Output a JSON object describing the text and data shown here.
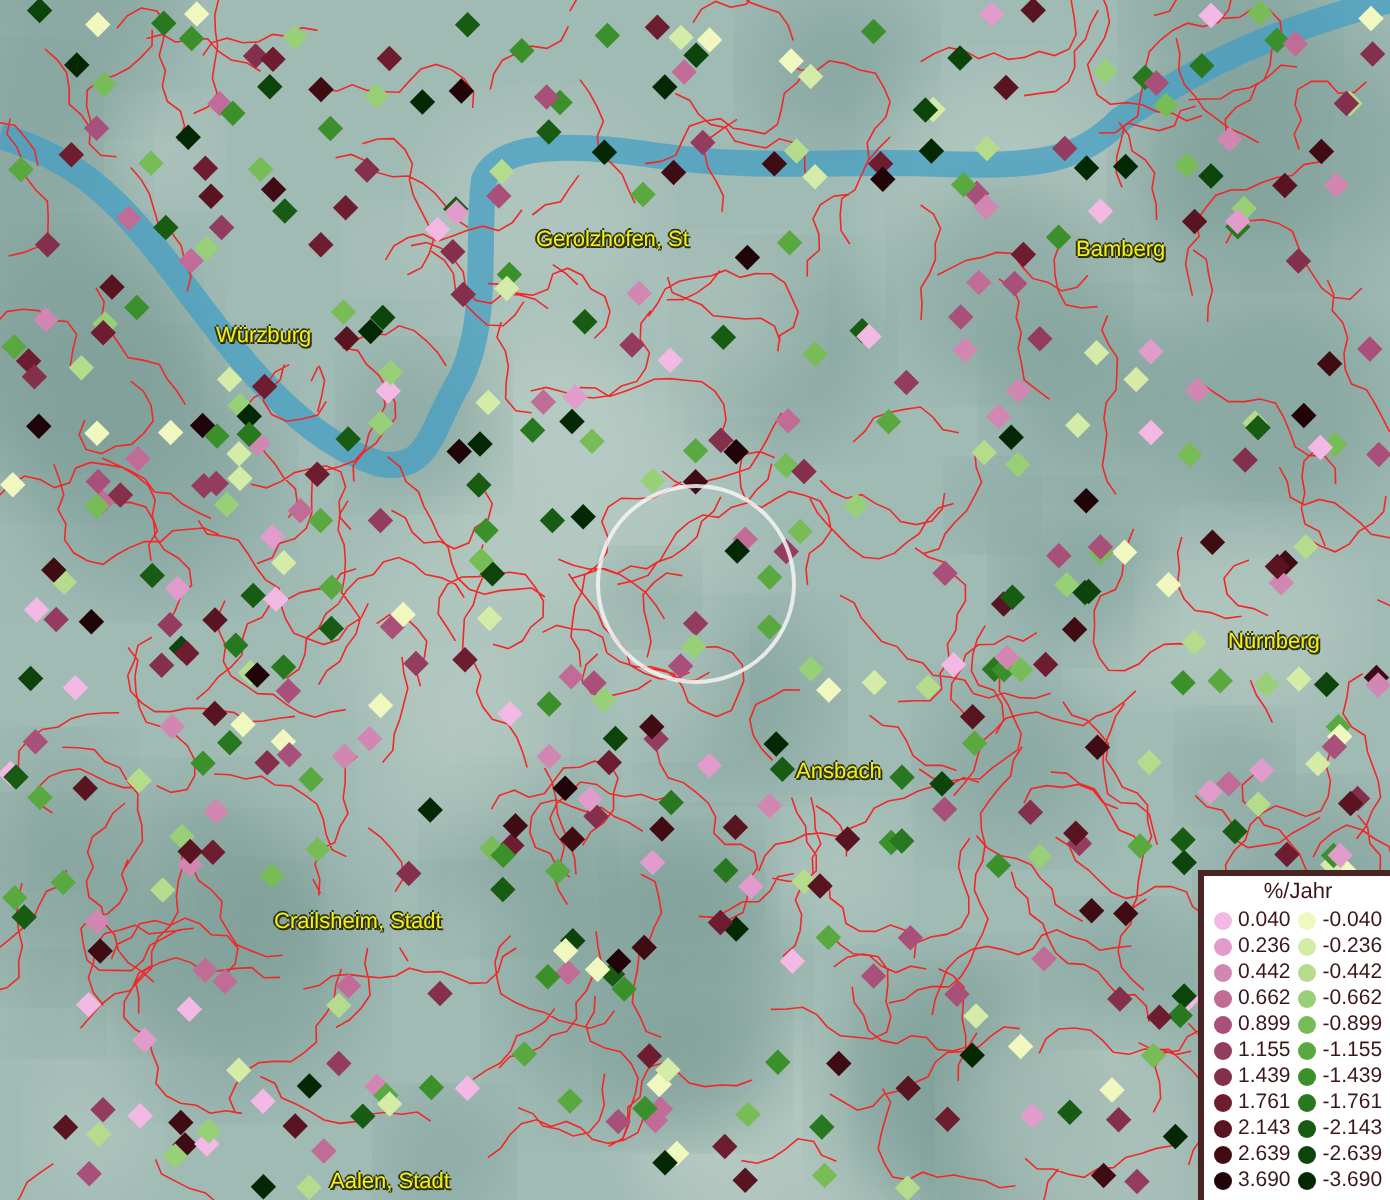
{
  "map": {
    "places": [
      {
        "name": "Würzburg"
      },
      {
        "name": "Gerolzhofen, St"
      },
      {
        "name": "Bamberg"
      },
      {
        "name": "Nürnberg"
      },
      {
        "name": "Ansbach"
      },
      {
        "name": "Crailsheim, Stadt"
      },
      {
        "name": "Aalen, Stadt"
      }
    ]
  },
  "legend": {
    "title": "%/Jahr",
    "entries": [
      {
        "label": "0.040",
        "color": "#f4b8e4"
      },
      {
        "label": "-0.040",
        "color": "#f0f8c0"
      },
      {
        "label": "0.236",
        "color": "#e29ccc"
      },
      {
        "label": "-0.236",
        "color": "#d4eca8"
      },
      {
        "label": "0.442",
        "color": "#d286b2"
      },
      {
        "label": "-0.442",
        "color": "#b4dc8c"
      },
      {
        "label": "0.662",
        "color": "#c06c96"
      },
      {
        "label": "-0.662",
        "color": "#98d078"
      },
      {
        "label": "0.899",
        "color": "#a8507a"
      },
      {
        "label": "-0.899",
        "color": "#78bc58"
      },
      {
        "label": "1.155",
        "color": "#943c60"
      },
      {
        "label": "-1.155",
        "color": "#5aa840"
      },
      {
        "label": "1.439",
        "color": "#84304c"
      },
      {
        "label": "-1.439",
        "color": "#3c902c"
      },
      {
        "label": "1.761",
        "color": "#6e1c30"
      },
      {
        "label": "-1.761",
        "color": "#287820"
      },
      {
        "label": "2.143",
        "color": "#581420"
      },
      {
        "label": "-2.143",
        "color": "#185c14"
      },
      {
        "label": "2.639",
        "color": "#400c14"
      },
      {
        "label": "-2.639",
        "color": "#0c440c"
      },
      {
        "label": "3.690",
        "color": "#200408"
      },
      {
        "label": "-3.690",
        "color": "#042804"
      }
    ]
  }
}
